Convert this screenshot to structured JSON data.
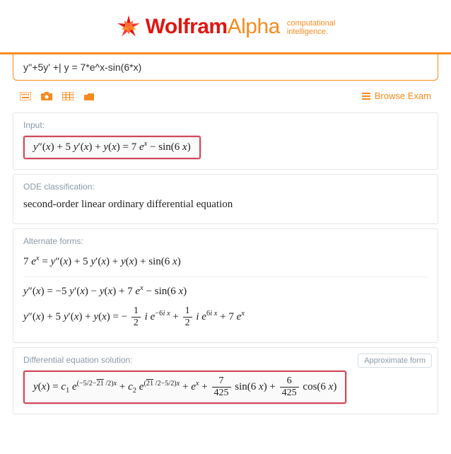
{
  "brand": {
    "bold": "Wolfram",
    "thin": "Alpha",
    "sub1": "computational",
    "sub2": "intelligence."
  },
  "search": {
    "query": "y''+5y' +| y = 7*e^x-sin(6*x)"
  },
  "toolbar": {
    "browse": "Browse Exam"
  },
  "pods": {
    "input": {
      "title": "Input:",
      "expr_html": "<i>y</i>″(<i>x</i>) + 5 <i>y</i>′(<i>x</i>) + <i>y</i>(<i>x</i>) = 7 <i>e</i><span class='sup'><i>x</i></span> − sin(6 <i>x</i>)"
    },
    "ode": {
      "title": "ODE classification:",
      "text": "second-order linear ordinary differential equation"
    },
    "alt": {
      "title": "Alternate forms:",
      "line1_html": "7 <i>e</i><span class='sup'><i>x</i></span> = <i>y</i>″(<i>x</i>) + 5 <i>y</i>′(<i>x</i>) + <i>y</i>(<i>x</i>) + sin(6 <i>x</i>)",
      "line2_html": "<i>y</i>″(<i>x</i>) = −5 <i>y</i>′(<i>x</i>) − <i>y</i>(<i>x</i>) + 7 <i>e</i><span class='sup'><i>x</i></span> − sin(6 <i>x</i>)",
      "line3_html": "<i>y</i>″(<i>x</i>) + 5 <i>y</i>′(<i>x</i>) + <i>y</i>(<i>x</i>) = − <span class='frac'><span class='n'>1</span><span class='d'>2</span></span> <i>i</i> <i>e</i><span class='sup'>−6<i>i x</i></span> + <span class='frac'><span class='n'>1</span><span class='d'>2</span></span> <i>i</i> <i>e</i><span class='sup'>6<i>i x</i></span> + 7 <i>e</i><span class='sup'><i>x</i></span>"
    },
    "sol": {
      "title": "Differential equation solution:",
      "button": "Approximate form",
      "expr_html": "<i>y</i>(<i>x</i>) = <i>c</i><span class='sub'>1</span> <i>e</i><span class='expo'>(−5/2−<span class='sqrt'>21</span> /2)<i>x</i></span> + <i>c</i><span class='sub'>2</span> <i>e</i><span class='expo'>(<span class='sqrt'>21</span> /2−5/2)<i>x</i></span> + <i>e</i><span class='sup'><i>x</i></span> + <span class='frac'><span class='n'>7</span><span class='d'>425</span></span> sin(6 <i>x</i>) + <span class='frac'><span class='n'>6</span><span class='d'>425</span></span> cos(6 <i>x</i>)"
    }
  },
  "chart_data": {
    "type": "table",
    "title": "Wolfram|Alpha ODE query result",
    "query": "y''+5y' + y = 7*e^x-sin(6*x)",
    "input_interpretation": "y''(x) + 5 y'(x) + y(x) = 7 e^x - sin(6 x)",
    "ode_classification": "second-order linear ordinary differential equation",
    "alternate_forms": [
      "7 e^x = y''(x) + 5 y'(x) + y(x) + sin(6 x)",
      "y''(x) = -5 y'(x) - y(x) + 7 e^x - sin(6 x)",
      "y''(x) + 5 y'(x) + y(x) = -(1/2) i e^{-6 i x} + (1/2) i e^{6 i x} + 7 e^x"
    ],
    "solution": "y(x) = c1 e^{(-5/2 - sqrt(21)/2) x} + c2 e^{(sqrt(21)/2 - 5/2) x} + e^x + (7/425) sin(6 x) + (6/425) cos(6 x)"
  }
}
